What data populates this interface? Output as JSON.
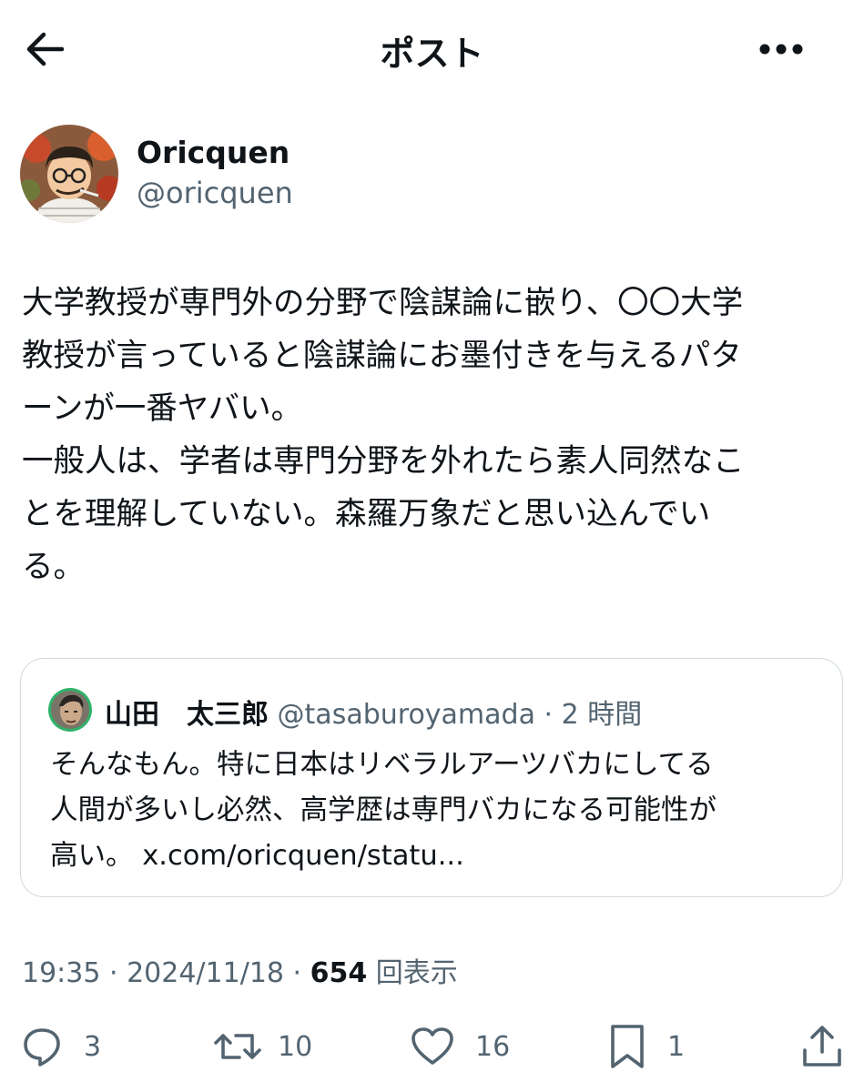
{
  "header": {
    "title": "ポスト",
    "back_icon": "arrow-left-icon",
    "more_icon": "more-horizontal-icon"
  },
  "author": {
    "name": "Oricquen",
    "handle": "@oricquen"
  },
  "tweet": {
    "text": "大学教授が専門外の分野で陰謀論に嵌り、〇〇大学\n教授が言っていると陰謀論にお墨付きを与えるパタ\nーンが一番ヤバい。\n一般人は、学者は専門分野を外れたら素人同然なこ\nとを理解していない。森羅万象だと思い込んでい\nる。"
  },
  "quote": {
    "name": "山田　太三郎",
    "handle": "@tasaburoyamada",
    "time": " · 2 時間",
    "text": "そんなもん。特に日本はリベラルアーツバカにしてる\n人間が多いし必然、高学歴は専門バカになる可能性が\n高い。 x.com/oricquen/statu..."
  },
  "meta": {
    "time": "19:35",
    "date": "2024/11/18",
    "views": "654",
    "views_label": "回表示",
    "sep": " · "
  },
  "actions": {
    "replies": "3",
    "reposts": "10",
    "likes": "16",
    "bookmarks": "1"
  }
}
